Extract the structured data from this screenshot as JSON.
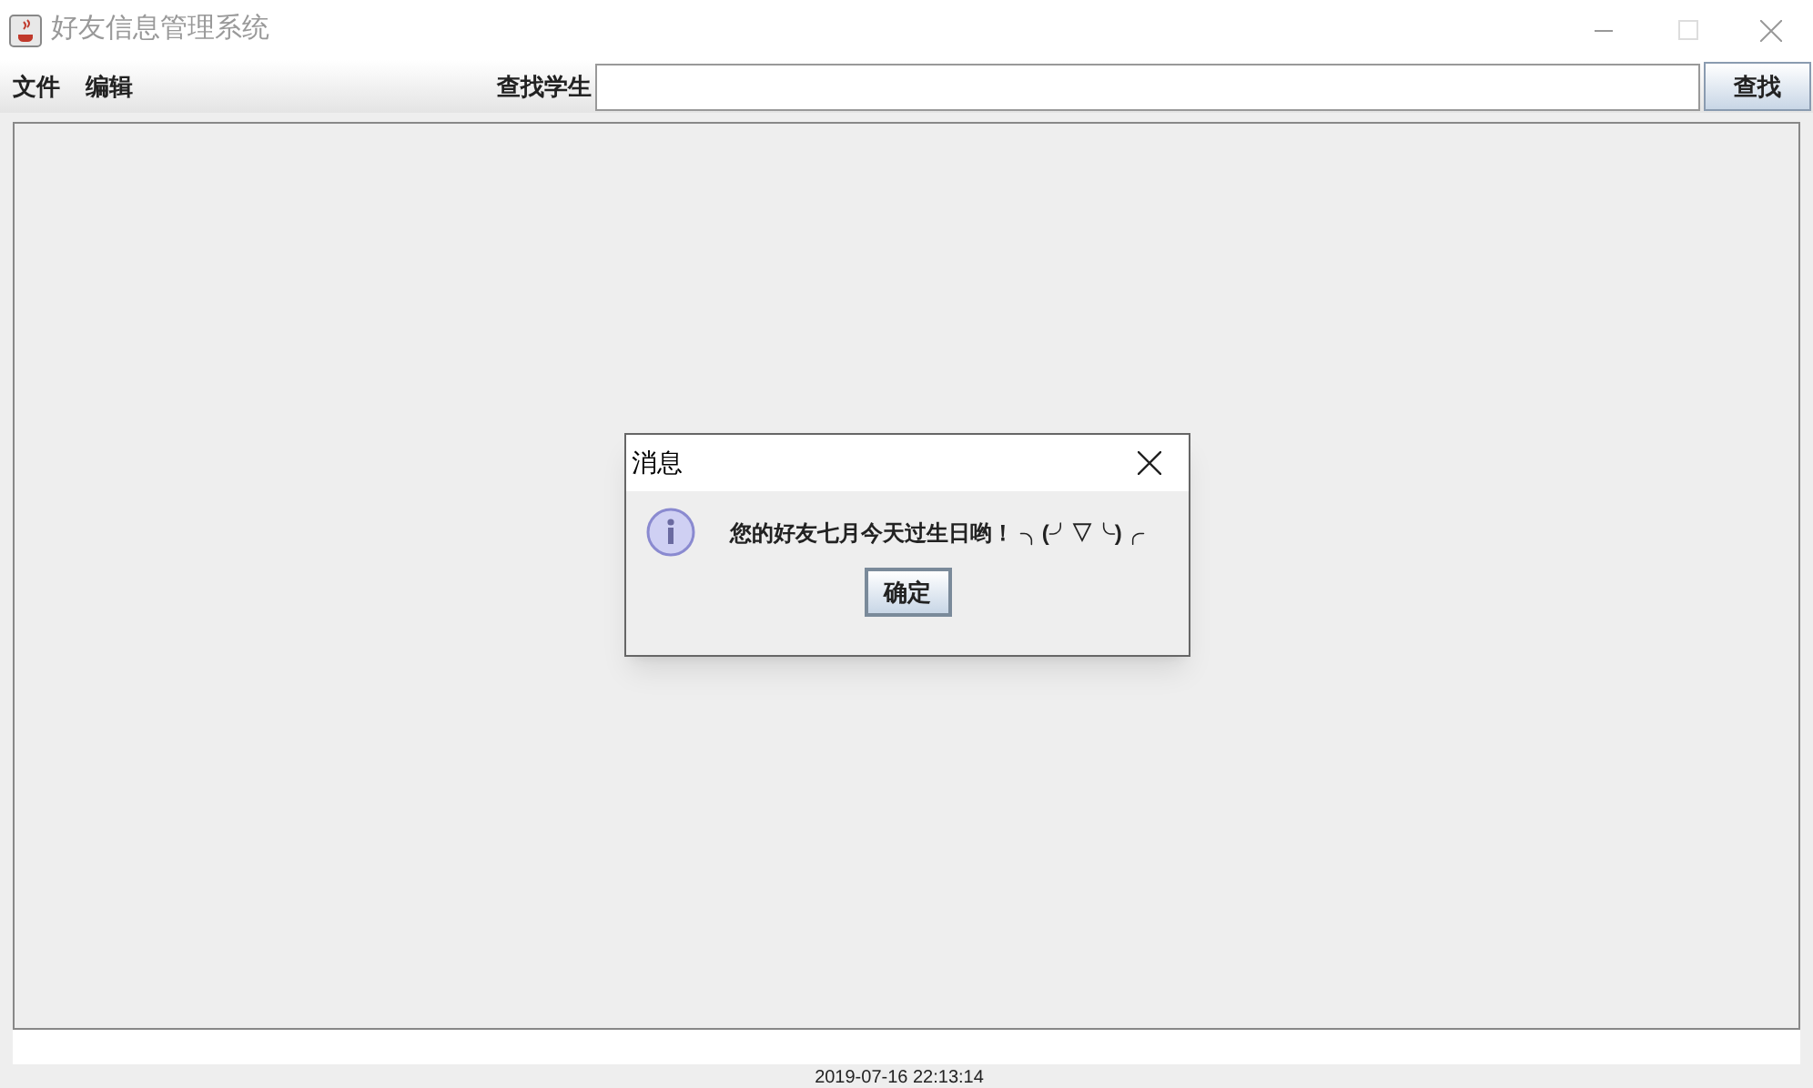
{
  "window": {
    "title": "好友信息管理系统"
  },
  "menu": [
    {
      "label": "文件"
    },
    {
      "label": "编辑"
    }
  ],
  "search": {
    "label": "查找学生",
    "button": "查找"
  },
  "status_bar": {
    "text": "2019-07-16 22:13:14"
  },
  "dialog": {
    "title": "消息",
    "message": "您的好友七月今天过生日哟！ ╮(╯▽╰)╭",
    "button": "确定"
  }
}
